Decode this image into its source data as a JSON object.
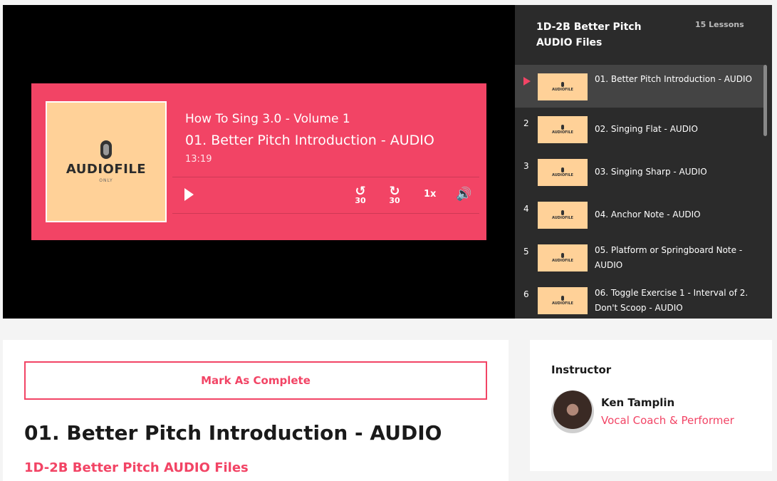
{
  "player": {
    "album": "How To Sing 3.0 - Volume 1",
    "track": "01. Better Pitch Introduction - AUDIO",
    "duration": "13:19",
    "cover_logo": "AUDIOFILE",
    "cover_sub": "ONLY",
    "rewind_seconds": "30",
    "forward_seconds": "30",
    "playback_rate": "1x",
    "play_icon": "play-icon",
    "volume_icon": "volume-icon"
  },
  "sidebar": {
    "title": "1D-2B Better Pitch AUDIO Files",
    "count": "15 Lessons",
    "thumb_logo": "AUDIOFILE",
    "items": [
      {
        "num": "",
        "label": "01. Better Pitch Introduction - AUDIO",
        "active": true
      },
      {
        "num": "2",
        "label": "02. Singing Flat - AUDIO"
      },
      {
        "num": "3",
        "label": "03. Singing Sharp - AUDIO"
      },
      {
        "num": "4",
        "label": "04. Anchor Note - AUDIO"
      },
      {
        "num": "5",
        "label": "05. Platform or Springboard Note - AUDIO"
      },
      {
        "num": "6",
        "label": "06. Toggle Exercise 1 - Interval of 2. Don't Scoop - AUDIO"
      }
    ]
  },
  "main": {
    "mark_complete": "Mark As Complete",
    "lesson_title": "01. Better Pitch Introduction - AUDIO",
    "course_link": "1D-2B Better Pitch AUDIO Files"
  },
  "instructor": {
    "heading": "Instructor",
    "name": "Ken Tamplin",
    "role": "Vocal Coach & Performer"
  },
  "colors": {
    "accent": "#f24465",
    "cover": "#ffd198",
    "sidebar_bg": "#2b2b2b"
  }
}
